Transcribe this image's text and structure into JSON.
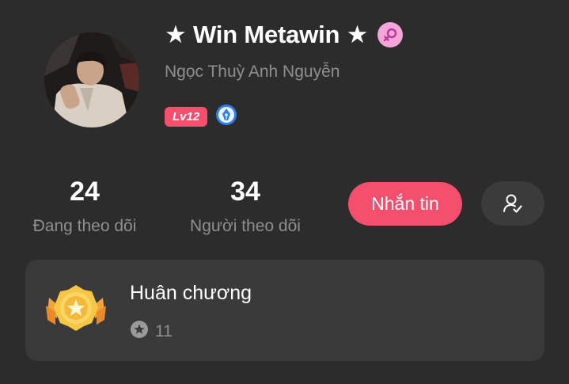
{
  "profile": {
    "display_name": "★ Win Metawin ★",
    "username": "Ngọc Thuỳ Anh Nguyễn",
    "gender_icon": "female-symbol-icon",
    "level": "Lv12",
    "achievement_icon": "pen-nib-badge-icon"
  },
  "stats": {
    "following_count": "24",
    "following_label": "Đang theo dõi",
    "followers_count": "34",
    "followers_label": "Người theo dõi"
  },
  "actions": {
    "message_label": "Nhắn tin",
    "follow_status_icon": "user-check-icon"
  },
  "medals": {
    "title": "Huân chương",
    "count": "11",
    "medal_icon": "gold-star-medal-icon",
    "count_icon": "star-circle-icon"
  },
  "colors": {
    "background": "#2c2c2c",
    "card": "#3a3a3a",
    "accent": "#f4506e",
    "muted_text": "#8f8f8f",
    "gender_badge": "#f3a7d8"
  }
}
